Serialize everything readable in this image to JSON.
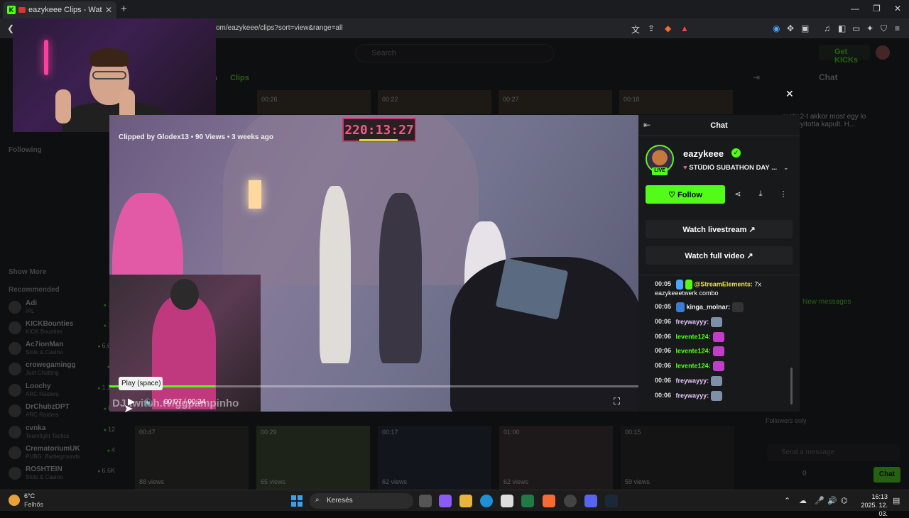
{
  "browser": {
    "tab_title": "eazykeee Clips - Watch Live o",
    "url": "om/eazykeee/clips?sort=view&range=all"
  },
  "header": {
    "search_placeholder": "Search",
    "get_kicks": "Get KICKs"
  },
  "page": {
    "tab_clips": "Clips",
    "tab_partial": "s",
    "chat_title": "Chat",
    "top_durations": [
      "00:26",
      "00:22",
      "00:27",
      "00:18"
    ]
  },
  "sidebar": {
    "following": "Following",
    "show_more": "Show More",
    "recommended": "Recommended",
    "items": [
      {
        "name": "Adi",
        "category": "IRL",
        "viewers": "14"
      },
      {
        "name": "KICKBounties",
        "category": "KICK Bounties",
        "viewers": "13"
      },
      {
        "name": "Ac7ionMan",
        "category": "Slots & Casino",
        "viewers": "6.6K"
      },
      {
        "name": "crowegamingg",
        "category": "Just Chatting",
        "viewers": "5"
      },
      {
        "name": "Loochy",
        "category": "ARC Raiders",
        "viewers": "1.1K"
      },
      {
        "name": "DrChubzDPT",
        "category": "ARC Raiders",
        "viewers": "83"
      },
      {
        "name": "cvnka",
        "category": "Teamfight Tactics",
        "viewers": "12"
      },
      {
        "name": "CrematoriumUK",
        "category": "PUBG: Battlegrounds",
        "viewers": "4"
      },
      {
        "name": "ROSHTEIN",
        "category": "Slots & Casino",
        "viewers": "6.6K"
      }
    ]
  },
  "video": {
    "clip_info": "Clipped by Glodex13 • 90 Views • 3 weeks ago",
    "counter": "220:13:27",
    "tooltip": "Play (space)",
    "time": "00:07 / 00:34",
    "watermark": "DJ twitch.tv/ggpampinho",
    "progress": 0.2
  },
  "clip_panel": {
    "title": "Chat",
    "streamer": "eazykeee",
    "live_badge": "LIVE",
    "stream_title": "STÚDIÓ SUBATHON DAY ...",
    "follow": "Follow",
    "watch_livestream": "Watch livestream",
    "watch_full_video": "Watch full video",
    "messages": [
      {
        "time": "00:05",
        "user": "@StreamElements:",
        "text": "7x",
        "color": "#f0e14a"
      },
      {
        "time": "",
        "user": "",
        "text": "eazykeeetwerk combo",
        "color": "#ffffff"
      },
      {
        "time": "00:05",
        "user": "kinga_molnar:",
        "text": "",
        "color": "#f4f4f4"
      },
      {
        "time": "00:06",
        "user": "freywayyy:",
        "text": "",
        "color": "#e5c6ff"
      },
      {
        "time": "00:06",
        "user": "levente124:",
        "text": "",
        "color": "#53fc18"
      },
      {
        "time": "00:06",
        "user": "levente124:",
        "text": "",
        "color": "#53fc18"
      },
      {
        "time": "00:06",
        "user": "levente124:",
        "text": "",
        "color": "#53fc18"
      },
      {
        "time": "00:06",
        "user": "freywayyy:",
        "text": "",
        "color": "#e5c6ff"
      },
      {
        "time": "00:06",
        "user": "freywayyy:",
        "text": "",
        "color": "#e5c6ff"
      }
    ]
  },
  "clips_bottom": [
    {
      "duration": "00:47",
      "views": "88 views"
    },
    {
      "duration": "00:29",
      "views": "65 views"
    },
    {
      "duration": "00:17",
      "views": "62 views"
    },
    {
      "duration": "01:00",
      "views": "62 views"
    },
    {
      "duration": "00:15",
      "views": "59 views"
    }
  ],
  "right_chat": {
    "followers_only": "Followers only",
    "send_placeholder": "Send a message",
    "chat_button": "Chat",
    "new_messages": "New messages",
    "pinned_text": "metin2-t akkor most egy lo megnyitotta kapult. H...",
    "count": "0"
  },
  "taskbar": {
    "temp": "6°C",
    "condition": "Felhős",
    "search": "Keresés",
    "time": "16:13",
    "date": "2025. 12. 03."
  }
}
